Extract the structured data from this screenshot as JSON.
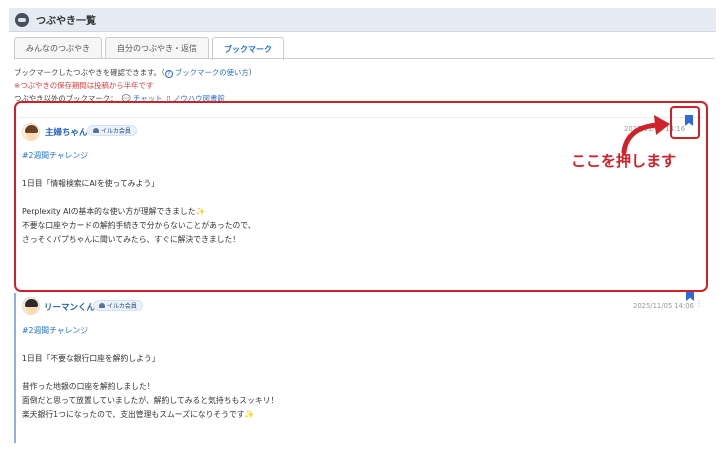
{
  "header": {
    "title": "つぶやき一覧",
    "logo_icon": "chat-bubble-icon"
  },
  "tabs": [
    {
      "label": "みんなのつぶやき",
      "active": false
    },
    {
      "label": "自分のつぶやき・返信",
      "active": false
    },
    {
      "label": "ブックマーク",
      "active": true
    }
  ],
  "info": {
    "description": "ブックマークしたつぶやきを確認できます。（",
    "help_link": "ブックマークの使い方",
    "description_end": "）",
    "notice": "※つぶやきの保存期間は投稿から半年です",
    "other_label": "つぶやき以外のブックマーク：",
    "link_chat": "チャット",
    "link_knowhow": "ノウハウ図書館"
  },
  "posts": [
    {
      "user": "主婦ちゃん",
      "badge": "イルカ会員",
      "timestamp": "2025/11/05 14:16",
      "bookmarked": true,
      "tag": "#2週間チャレンジ",
      "lines": [
        "1日目「情報検索にAIを使ってみよう」",
        "Perplexity AIの基本的な使い方が理解できました",
        "不要な口座やカードの解約手続きで分からないことがあったので、",
        "さっそくパプちゃんに聞いてみたら、すぐに解決できました！"
      ]
    },
    {
      "user": "リーマンくん",
      "badge": "イルカ会員",
      "timestamp": "2025/11/05 14:06",
      "bookmarked": true,
      "tag": "#2週間チャレンジ",
      "lines": [
        "1日目「不要な銀行口座を解約しよう」",
        "昔作った地銀の口座を解約しました！",
        "面倒だと思って放置していましたが、解約してみると気持ちもスッキリ！",
        "楽天銀行1つになったので、支出管理もスムーズになりそうです"
      ]
    }
  ],
  "annotation": {
    "text": "ここを押します",
    "color": "#d0202a"
  },
  "colors": {
    "accent": "#1f6fd0",
    "notice": "#e03a3a",
    "bookmark": "#2f6bd8"
  }
}
